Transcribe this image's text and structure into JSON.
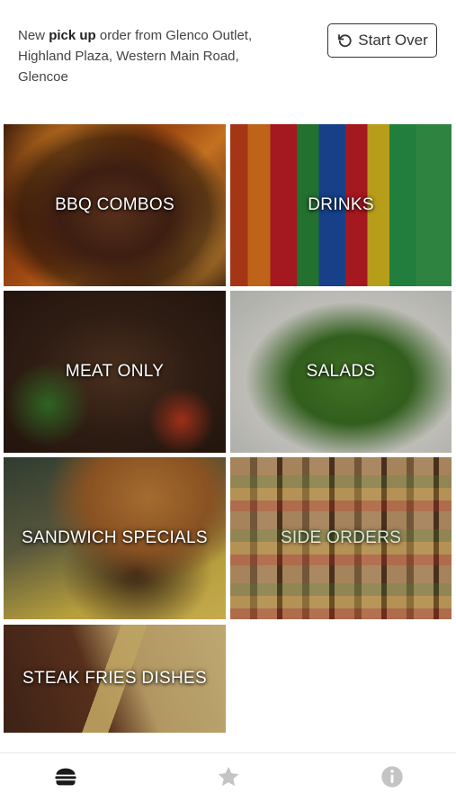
{
  "header": {
    "order_prefix": "New",
    "order_type": "pick up",
    "order_suffix": "order",
    "location_line": "from Glenco Outlet, Highland Plaza, Western Main Road, Glencoe",
    "start_over_label": "Start Over"
  },
  "categories": [
    {
      "label": "BBQ COMBOS"
    },
    {
      "label": "DRINKS"
    },
    {
      "label": "MEAT ONLY"
    },
    {
      "label": "SALADS"
    },
    {
      "label": "SANDWICH SPECIALS"
    },
    {
      "label": "SIDE ORDERS"
    },
    {
      "label": "STEAK FRIES DISHES"
    }
  ],
  "tabbar": {
    "items": [
      {
        "icon": "burger-icon",
        "active": true
      },
      {
        "icon": "star-icon",
        "active": false
      },
      {
        "icon": "info-icon",
        "active": false
      }
    ],
    "active_color": "#1a1a1a",
    "inactive_color": "#c4c4c4"
  }
}
